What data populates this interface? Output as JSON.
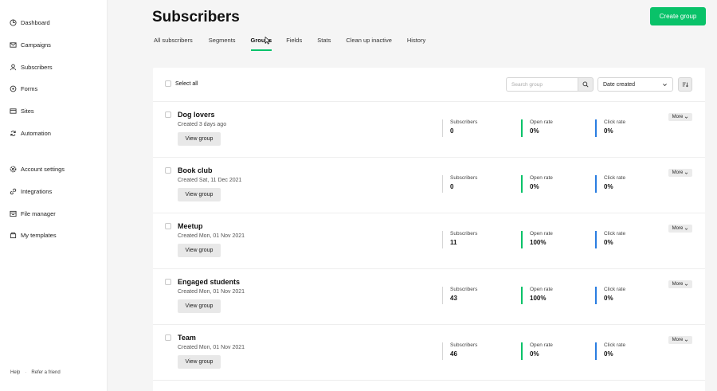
{
  "sidebar": {
    "items": [
      {
        "label": "Dashboard",
        "icon": "dashboard-icon"
      },
      {
        "label": "Campaigns",
        "icon": "mail-icon"
      },
      {
        "label": "Subscribers",
        "icon": "user-icon"
      },
      {
        "label": "Forms",
        "icon": "forms-icon"
      },
      {
        "label": "Sites",
        "icon": "sites-icon"
      },
      {
        "label": "Automation",
        "icon": "refresh-icon"
      },
      {
        "label": "Account settings",
        "icon": "gear-icon"
      },
      {
        "label": "Integrations",
        "icon": "link-icon"
      },
      {
        "label": "File manager",
        "icon": "file-manager-icon"
      },
      {
        "label": "My templates",
        "icon": "templates-icon"
      }
    ],
    "footer": {
      "help": "Help",
      "separator": "·",
      "refer": "Refer a friend"
    }
  },
  "header": {
    "title": "Subscribers",
    "create_label": "Create group"
  },
  "tabs": [
    {
      "label": "All subscribers",
      "active": false
    },
    {
      "label": "Segments",
      "active": false
    },
    {
      "label": "Groups",
      "active": true
    },
    {
      "label": "Fields",
      "active": false
    },
    {
      "label": "Stats",
      "active": false
    },
    {
      "label": "Clean up inactive",
      "active": false
    },
    {
      "label": "History",
      "active": false
    }
  ],
  "toolbar": {
    "select_all": "Select all",
    "search_placeholder": "Search group",
    "sort_value": "Date created"
  },
  "labels": {
    "subscribers": "Subscribers",
    "open_rate": "Open rate",
    "click_rate": "Click rate",
    "view_group": "View group",
    "more": "More"
  },
  "groups": [
    {
      "name": "Dog lovers",
      "created": "Created 3 days ago",
      "subscribers": "0",
      "open_rate": "0%",
      "click_rate": "0%"
    },
    {
      "name": "Book club",
      "created": "Created Sat, 11 Dec 2021",
      "subscribers": "0",
      "open_rate": "0%",
      "click_rate": "0%"
    },
    {
      "name": "Meetup",
      "created": "Created Mon, 01 Nov 2021",
      "subscribers": "11",
      "open_rate": "100%",
      "click_rate": "0%"
    },
    {
      "name": "Engaged students",
      "created": "Created Mon, 01 Nov 2021",
      "subscribers": "43",
      "open_rate": "100%",
      "click_rate": "0%"
    },
    {
      "name": "Team",
      "created": "Created Mon, 01 Nov 2021",
      "subscribers": "46",
      "open_rate": "0%",
      "click_rate": "0%"
    }
  ],
  "colors": {
    "accent": "#09c269",
    "click": "#2a7de1"
  }
}
